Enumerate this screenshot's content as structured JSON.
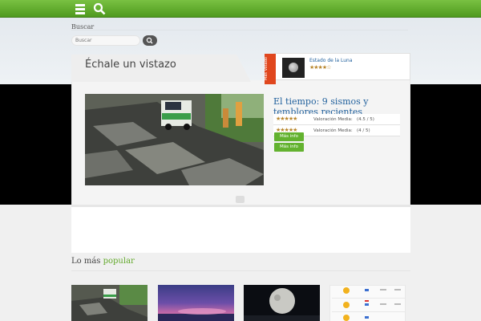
{
  "search": {
    "label": "Buscar",
    "placeholder": "Buscar"
  },
  "featured": {
    "heading": "Échale un vistazo",
    "title": "El tiempo: 9 sismos y temblores recientes",
    "ratings": [
      {
        "stars": "★★★★★",
        "label": "Valoración Media:",
        "value": "(4.5 / 5)"
      },
      {
        "stars": "★★★★★",
        "label": "Valoración Media:",
        "value": "(4 / 5)"
      }
    ],
    "buttons": [
      "Más info",
      "Más info"
    ]
  },
  "sidebar": {
    "ribbon": "Más Votado",
    "item_title": "Estado de la Luna",
    "item_rating": "★★★★☆"
  },
  "popular": {
    "title_plain": "Lo más",
    "title_accent": "popular"
  },
  "icons": {
    "menu": "menu-icon",
    "search": "search-icon"
  }
}
